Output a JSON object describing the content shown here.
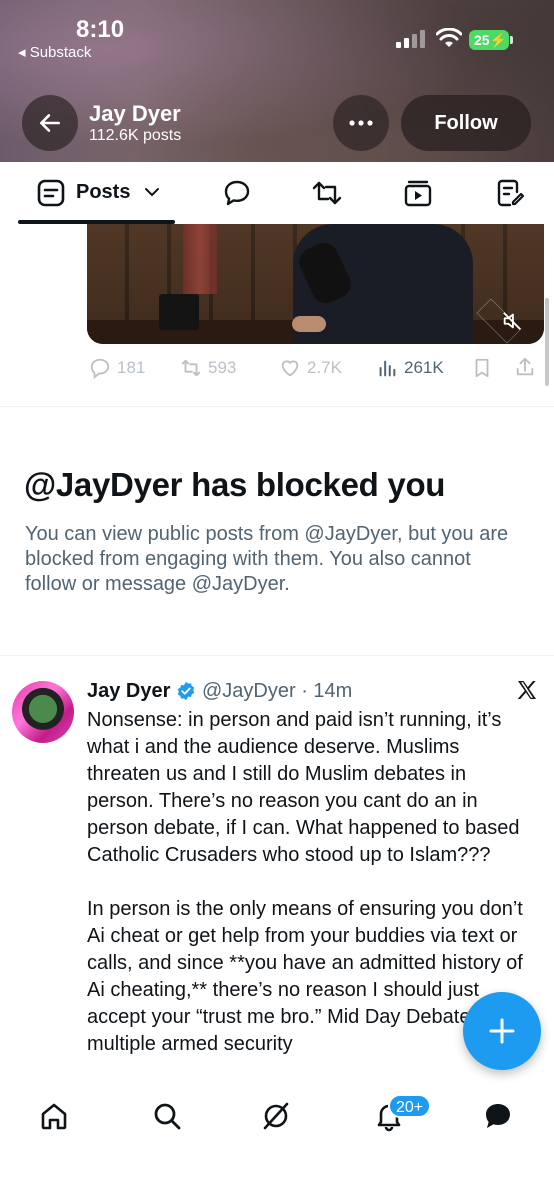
{
  "status_bar": {
    "time": "8:10",
    "back_app": "◂ Substack",
    "battery": "25"
  },
  "header": {
    "name": "Jay Dyer",
    "posts_count": "112.6K posts",
    "follow_label": "Follow"
  },
  "tabs": {
    "posts_label": "Posts",
    "icons": [
      "posts-icon",
      "chat-bubble-icon",
      "retweet-icon",
      "video-icon",
      "articles-icon"
    ]
  },
  "media_post": {
    "replies": "181",
    "reposts": "593",
    "likes": "2.7K",
    "views": "261K"
  },
  "blocked": {
    "title": "@JayDyer has blocked you",
    "description": "You can view public posts from @JayDyer, but you are blocked from engaging with them. You also cannot follow or message @JayDyer."
  },
  "tweet": {
    "author": "Jay Dyer",
    "handle_time": "@JayDyer · 14m",
    "text": "Nonsense: in person and paid isn’t running, it’s what i and the audience deserve. Muslims threaten us and I still do Muslim debates in person. There’s no reason you cant do an in person debate, if I can. What happened to based Catholic Crusaders who stood up to Islam???\n\nIn person is the only means of ensuring you don’t Ai cheat or get help from your buddies via text or calls, and since **you have an admitted history of Ai cheating,** there’s no reason I should just accept your “trust me bro.” Mid Day Debate offers multiple armed security"
  },
  "bottom_nav": {
    "notifications_badge": "20+",
    "items": [
      "home-icon",
      "search-icon",
      "grok-icon",
      "notifications-icon",
      "messages-icon"
    ]
  },
  "colors": {
    "accent": "#1d9bf0",
    "text_primary": "#0f1419",
    "text_secondary": "#536471"
  }
}
